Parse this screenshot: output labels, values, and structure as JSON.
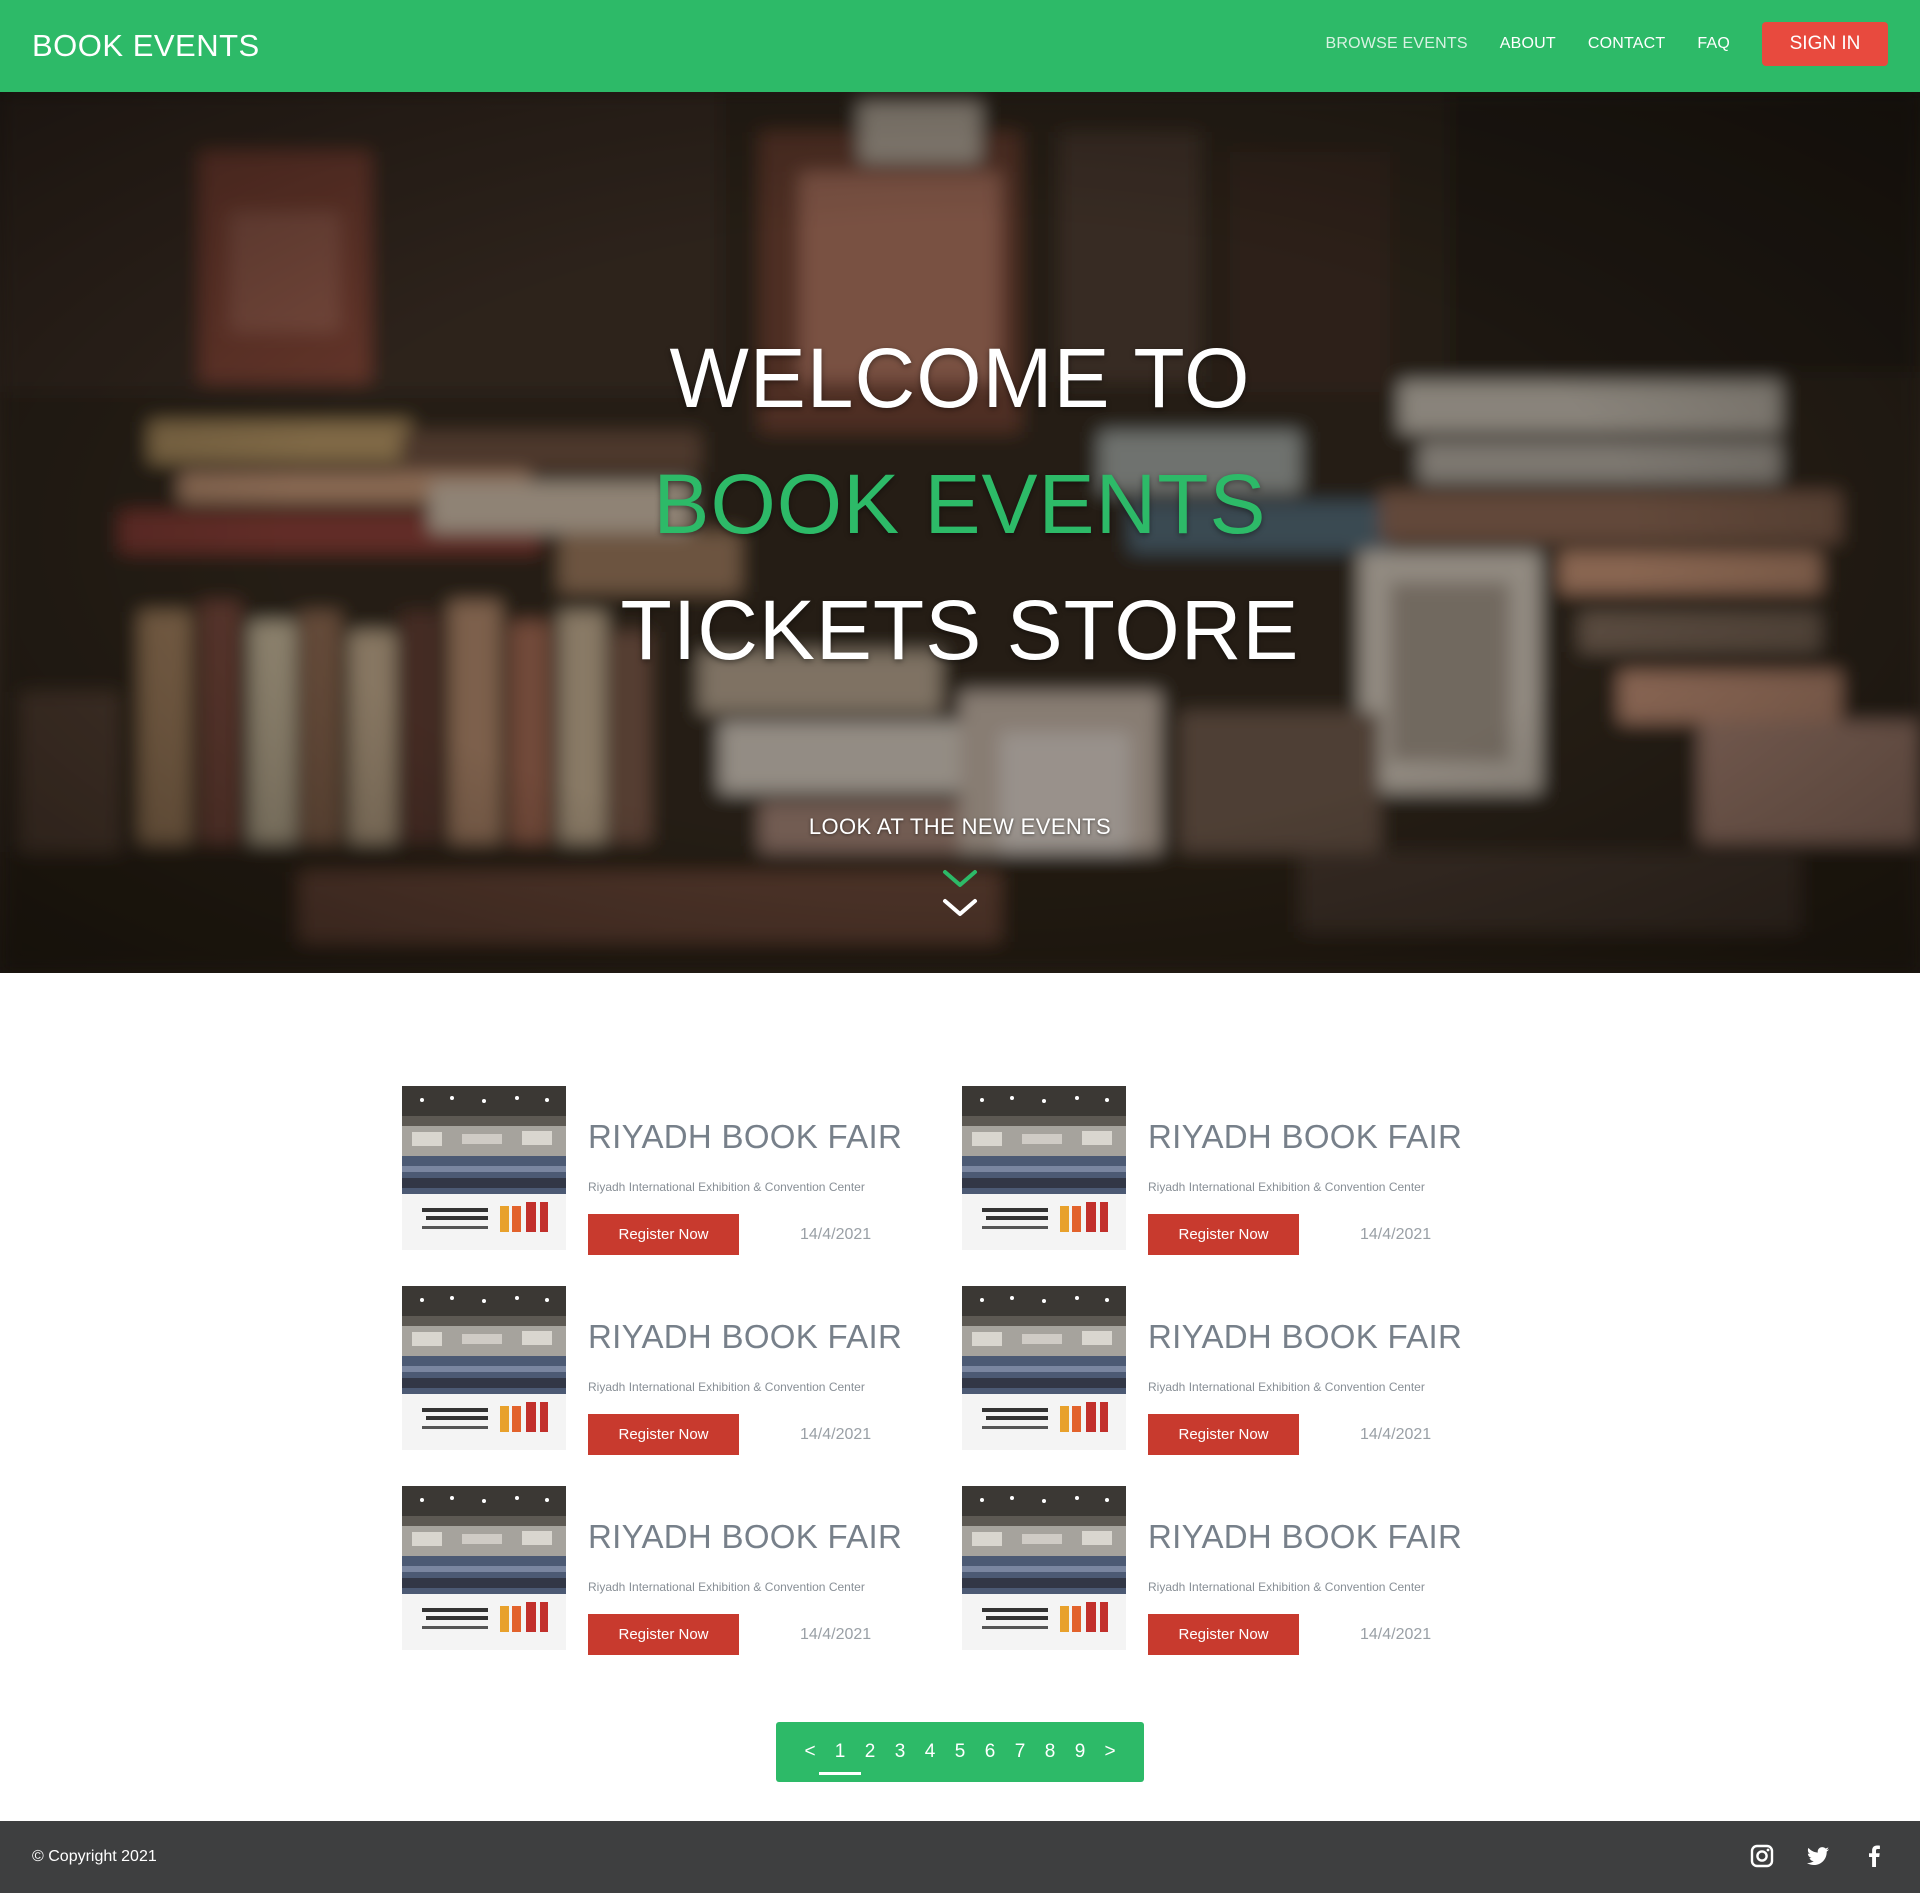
{
  "nav": {
    "brand": "BOOK EVENTS",
    "links": [
      "BROWSE EVENTS",
      "ABOUT",
      "CONTACT",
      "FAQ"
    ],
    "signin": "SIGN IN"
  },
  "hero": {
    "line1": "WELCOME TO",
    "line2": "BOOK EVENTS",
    "line3": "TICKETS STORE",
    "cta": "LOOK AT THE NEW EVENTS"
  },
  "events": [
    {
      "title": "RIYADH BOOK FAIR",
      "venue": "Riyadh International Exhibition & Convention Center",
      "button": "Register Now",
      "date": "14/4/2021"
    },
    {
      "title": "RIYADH BOOK FAIR",
      "venue": "Riyadh International Exhibition & Convention Center",
      "button": "Register Now",
      "date": "14/4/2021"
    },
    {
      "title": "RIYADH BOOK FAIR",
      "venue": "Riyadh International Exhibition & Convention Center",
      "button": "Register Now",
      "date": "14/4/2021"
    },
    {
      "title": "RIYADH BOOK FAIR",
      "venue": "Riyadh International Exhibition & Convention Center",
      "button": "Register Now",
      "date": "14/4/2021"
    },
    {
      "title": "RIYADH BOOK FAIR",
      "venue": "Riyadh International Exhibition & Convention Center",
      "button": "Register Now",
      "date": "14/4/2021"
    },
    {
      "title": "RIYADH BOOK FAIR",
      "venue": "Riyadh International Exhibition & Convention Center",
      "button": "Register Now",
      "date": "14/4/2021"
    }
  ],
  "pagination": {
    "prev": "<",
    "pages": [
      "1",
      "2",
      "3",
      "4",
      "5",
      "6",
      "7",
      "8",
      "9"
    ],
    "next": ">",
    "current": "1"
  },
  "footer": {
    "copyright": "© Copyright 2021",
    "social": [
      "instagram-icon",
      "twitter-icon",
      "facebook-icon"
    ]
  },
  "colors": {
    "primary": "#2dba68",
    "signin": "#e84a3e",
    "register": "#c83a2e",
    "footer": "#3e3f40"
  }
}
